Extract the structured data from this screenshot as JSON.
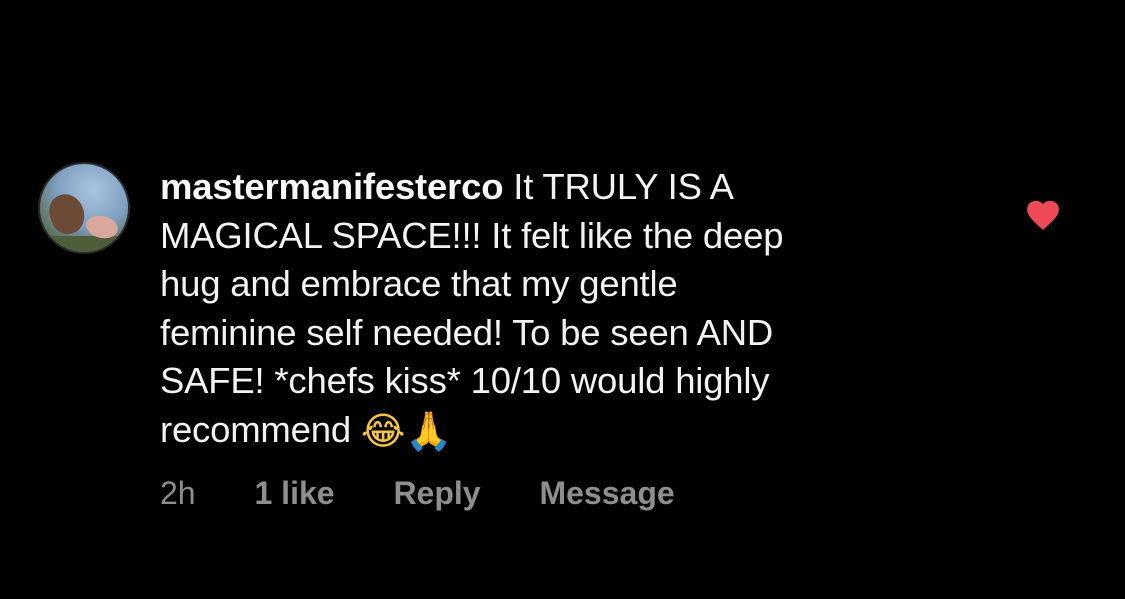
{
  "comment": {
    "username": "mastermanifesterco",
    "text_lines": [
      "It TRULY IS A",
      "MAGICAL SPACE!!! It felt like the deep",
      "hug and embrace that my gentle",
      "feminine self needed! To be seen AND",
      "SAFE! *chefs kiss* 10/10 would highly",
      "recommend"
    ],
    "emojis": {
      "laugh": "😂",
      "pray": "🙏"
    },
    "liked": true,
    "heart_color": "#ed4956"
  },
  "meta": {
    "time": "2h",
    "likes": "1 like",
    "reply": "Reply",
    "message": "Message"
  },
  "icons": {
    "avatar": "avatar-photo",
    "heart": "heart-filled-icon"
  }
}
